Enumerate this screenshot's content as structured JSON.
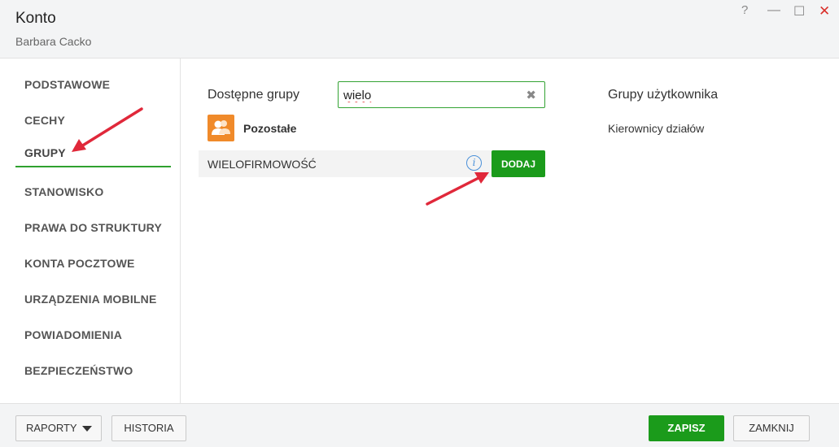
{
  "window": {
    "title": "Konto",
    "subtitle": "Barbara Cacko",
    "controls": {
      "help": "?",
      "minimize": "—",
      "maximize": "☐",
      "close": "✕"
    }
  },
  "sidebar": {
    "items": [
      {
        "label": "PODSTAWOWE"
      },
      {
        "label": "CECHY"
      },
      {
        "label": "GRUPY",
        "active": true
      },
      {
        "label": "STANOWISKO"
      },
      {
        "label": "PRAWA DO STRUKTURY"
      },
      {
        "label": "KONTA POCZTOWE"
      },
      {
        "label": "URZĄDZENIA MOBILNE"
      },
      {
        "label": "POWIADOMIENIA"
      },
      {
        "label": "BEZPIECZEŃSTWO"
      }
    ]
  },
  "available": {
    "label": "Dostępne grupy",
    "search_value": "wielo",
    "clear_icon": "✖",
    "group_icon": "users-icon",
    "group_name": "Pozostałe",
    "rows": [
      {
        "label": "WIELOFIRMOWOŚĆ",
        "info": "i",
        "action": "DODAJ"
      }
    ]
  },
  "user_groups": {
    "label": "Grupy użytkownika",
    "items": [
      "Kierownicy działów"
    ]
  },
  "footer": {
    "reports": "RAPORTY",
    "history": "HISTORIA",
    "save": "ZAPISZ",
    "close": "ZAMKNIJ"
  },
  "colors": {
    "accent_green": "#1b9b1b",
    "group_icon_orange": "#f08a2a",
    "annotation_red": "#e0283a",
    "info_blue": "#4a90d9"
  }
}
